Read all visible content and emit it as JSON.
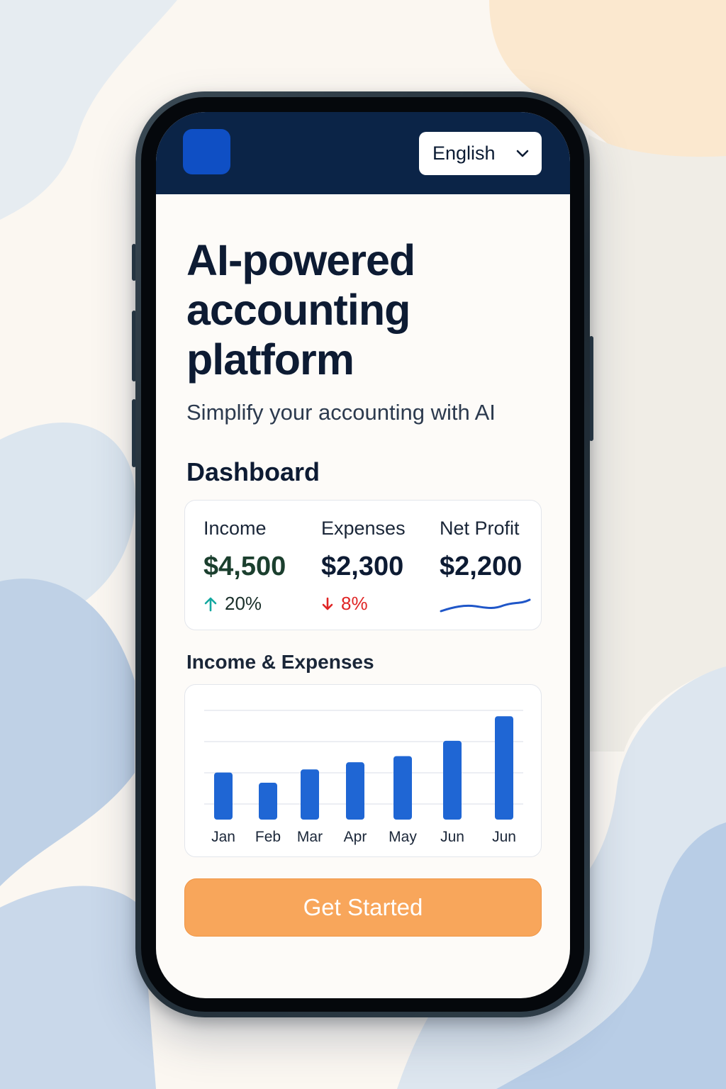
{
  "header": {
    "language": "English"
  },
  "hero": {
    "title_lines": [
      "AI-powered",
      "accounting",
      "platform"
    ],
    "subtitle": "Simplify your accounting with AI"
  },
  "dashboard": {
    "heading": "Dashboard",
    "stats": {
      "income": {
        "label": "Income",
        "value": "$4,500",
        "change": "20%",
        "trend": "up"
      },
      "expenses": {
        "label": "Expenses",
        "value": "$2,300",
        "change": "8%",
        "trend": "down"
      },
      "net_profit": {
        "label": "Net Profit",
        "value": "$2,200"
      }
    }
  },
  "chart_heading": "Income & Expenses",
  "chart_data": {
    "type": "bar",
    "categories": [
      "Jan",
      "Feb",
      "Mar",
      "Apr",
      "May",
      "Jun",
      "Jun"
    ],
    "values": [
      46,
      36,
      49,
      56,
      62,
      77,
      101
    ],
    "ylim": [
      0,
      115
    ],
    "grid": true,
    "title": "",
    "xlabel": "",
    "ylabel": ""
  },
  "cta": {
    "label": "Get Started"
  },
  "colors": {
    "header_bg": "#0b2447",
    "logo": "#0f4fc4",
    "bar": "#1f66d4",
    "income_up": "#14a8a0",
    "expense_down": "#e02424",
    "sparkline": "#1f56c8",
    "cta_bg": "#f8a65b"
  },
  "icons": {
    "language_dropdown": "chevron-down-icon",
    "income_trend": "arrow-up-icon",
    "expense_trend": "arrow-down-icon"
  }
}
